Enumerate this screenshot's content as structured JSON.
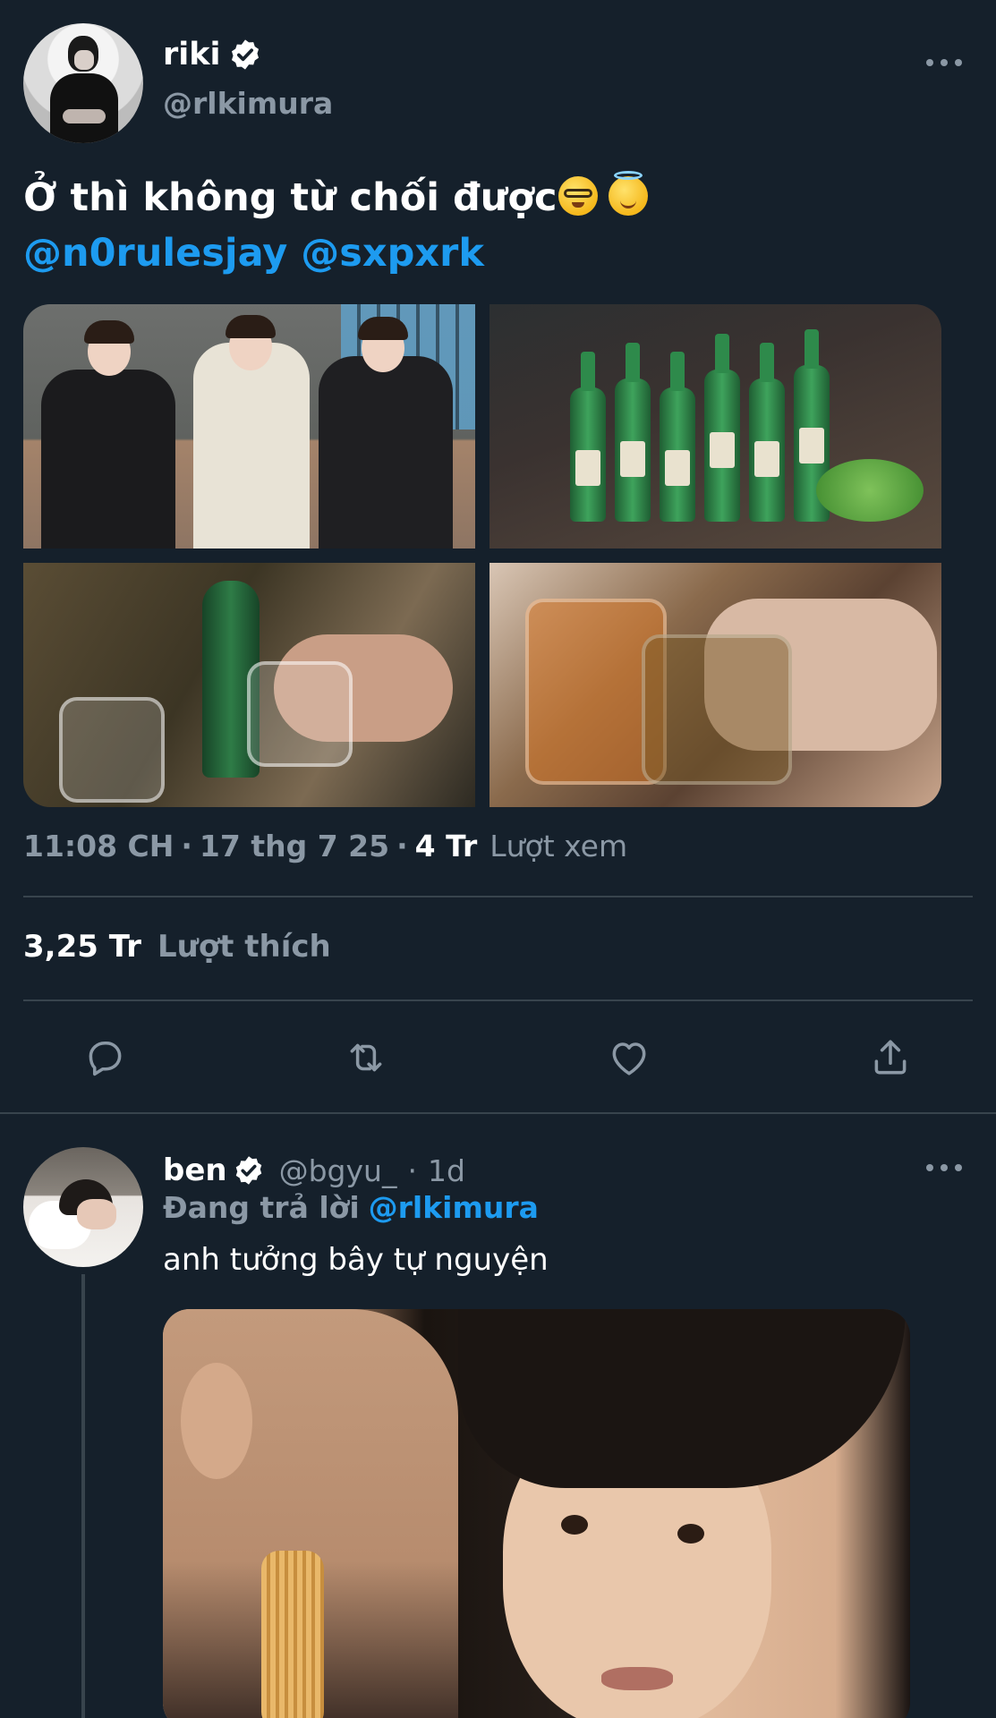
{
  "tweet": {
    "author": {
      "display_name": "riki",
      "handle": "@rlkimura",
      "avatar_icon": "profile-photo"
    },
    "text_main": "Ở thì không từ chối được",
    "emojis": [
      "nerd-face-emoji",
      "smiling-face-with-halo-emoji"
    ],
    "mentions": [
      "@n0rulesjay",
      "@sxpxrk"
    ],
    "media": [
      {
        "description_icon": "photo-three-people"
      },
      {
        "description_icon": "photo-soju-bottles"
      },
      {
        "description_icon": "photo-toasting-glasses"
      },
      {
        "description_icon": "photo-toasting-beer"
      }
    ],
    "time": "11:08 CH",
    "date": "17 thg 7 25",
    "views_count": "4 Tr",
    "views_label": "Lượt xem",
    "likes_count": "3,25 Tr",
    "likes_label": "Lượt thích",
    "actions": [
      "reply-icon",
      "retweet-icon",
      "like-icon",
      "share-icon"
    ]
  },
  "reply": {
    "author": {
      "display_name": "ben",
      "handle": "@bgyu_",
      "time": "1d"
    },
    "replying_label": "Đang trả lời",
    "replying_to": "@rlkimura",
    "text": "anh tưởng bây tự nguyện",
    "media_icon": "photo-meme"
  },
  "colors": {
    "background": "#15202b",
    "accent": "#1d9bf0",
    "muted": "#8b98a5",
    "divider": "#38444d",
    "text": "#ffffff"
  }
}
